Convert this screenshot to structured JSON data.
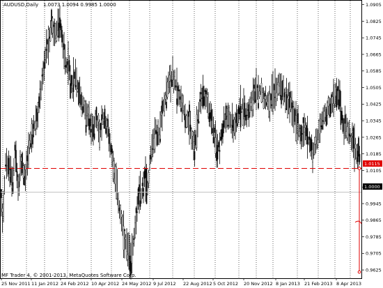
{
  "window": {
    "symbol_timeframe": "AUDUSD,Daily",
    "ohlc_readout": "1.0073 1.0094 0.9985 1.0000",
    "copyright": "MF Trader 4, © 2001-2013, MetaQuotes Software Corp."
  },
  "lines": {
    "bid_label": "1.0000",
    "order_level_label": "1.0115",
    "order_color": "#e00000",
    "bid_line_color": "#c0c0c0"
  },
  "chart_data": {
    "type": "candlestick",
    "title": "AUDUSD,Daily",
    "ylim": [
      0.9585,
      1.0924
    ],
    "y_ticks": [
      "1.0905",
      "1.0825",
      "1.0745",
      "1.0665",
      "1.0585",
      "1.0505",
      "1.0425",
      "1.0345",
      "1.0265",
      "1.0185",
      "1.0105",
      "1.0025",
      "0.9945",
      "0.9865",
      "0.9785",
      "0.9705",
      "0.9625"
    ],
    "x_ticks": [
      "25 Nov 2011",
      "11 Jan 2012",
      "24 Feb 2012",
      "10 Apr 2012",
      "24 May 2012",
      "9 Jul 2012",
      "22 Aug 2012",
      "5 Oct 2012",
      "20 Nov 2012",
      "8 Jan 2013",
      "21 Feb 2013",
      "8 Apr 2013"
    ],
    "grid": "vertical dotted",
    "series": [
      {
        "values": [
          [
            1,
            1.0
          ],
          [
            4,
            0.988
          ],
          [
            8,
            1.015
          ],
          [
            14,
            1.01
          ],
          [
            18,
            1.005
          ],
          [
            22,
            1.022
          ],
          [
            26,
            1.0
          ],
          [
            30,
            1.015
          ],
          [
            36,
            1.006
          ],
          [
            42,
            1.022
          ],
          [
            48,
            1.03
          ],
          [
            54,
            1.036
          ],
          [
            58,
            1.048
          ],
          [
            62,
            1.058
          ],
          [
            66,
            1.066
          ],
          [
            70,
            1.07
          ],
          [
            74,
            1.082
          ],
          [
            78,
            1.075
          ],
          [
            82,
            1.078
          ],
          [
            86,
            1.083
          ],
          [
            90,
            1.072
          ],
          [
            94,
            1.063
          ],
          [
            98,
            1.062
          ],
          [
            102,
            1.052
          ],
          [
            108,
            1.056
          ],
          [
            114,
            1.048
          ],
          [
            120,
            1.041
          ],
          [
            126,
            1.036
          ],
          [
            132,
            1.03
          ],
          [
            138,
            1.035
          ],
          [
            144,
            1.028
          ],
          [
            148,
            1.036
          ],
          [
            154,
            1.032
          ],
          [
            160,
            1.02
          ],
          [
            166,
            1.008
          ],
          [
            170,
            0.996
          ],
          [
            176,
            0.982
          ],
          [
            180,
            0.975
          ],
          [
            184,
            0.972
          ],
          [
            188,
            0.966
          ],
          [
            192,
            0.978
          ],
          [
            196,
            0.99
          ],
          [
            200,
            0.998
          ],
          [
            204,
            1.0
          ],
          [
            208,
            1.008
          ],
          [
            212,
            1.002
          ],
          [
            216,
            1.018
          ],
          [
            220,
            1.024
          ],
          [
            224,
            1.03
          ],
          [
            228,
            1.026
          ],
          [
            232,
            1.036
          ],
          [
            236,
            1.044
          ],
          [
            240,
            1.05
          ],
          [
            244,
            1.054
          ],
          [
            248,
            1.056
          ],
          [
            252,
            1.052
          ],
          [
            256,
            1.047
          ],
          [
            260,
            1.045
          ],
          [
            264,
            1.04
          ],
          [
            268,
            1.034
          ],
          [
            272,
            1.032
          ],
          [
            276,
            1.026
          ],
          [
            280,
            1.02
          ],
          [
            284,
            1.035
          ],
          [
            288,
            1.044
          ],
          [
            292,
            1.048
          ],
          [
            296,
            1.046
          ],
          [
            300,
            1.04
          ],
          [
            304,
            1.034
          ],
          [
            308,
            1.026
          ],
          [
            312,
            1.02
          ],
          [
            318,
            1.028
          ],
          [
            324,
            1.036
          ],
          [
            330,
            1.035
          ],
          [
            336,
            1.032
          ],
          [
            342,
            1.038
          ],
          [
            348,
            1.041
          ],
          [
            354,
            1.037
          ],
          [
            360,
            1.044
          ],
          [
            366,
            1.048
          ],
          [
            372,
            1.05
          ],
          [
            378,
            1.048
          ],
          [
            384,
            1.044
          ],
          [
            390,
            1.046
          ],
          [
            396,
            1.05
          ],
          [
            402,
            1.052
          ],
          [
            408,
            1.048
          ],
          [
            414,
            1.044
          ],
          [
            420,
            1.04
          ],
          [
            426,
            1.034
          ],
          [
            432,
            1.028
          ],
          [
            438,
            1.03
          ],
          [
            444,
            1.024
          ],
          [
            450,
            1.019
          ],
          [
            456,
            1.026
          ],
          [
            462,
            1.034
          ],
          [
            468,
            1.038
          ],
          [
            474,
            1.042
          ],
          [
            480,
            1.045
          ],
          [
            486,
            1.049
          ],
          [
            490,
            1.038
          ],
          [
            494,
            1.032
          ],
          [
            500,
            1.028
          ],
          [
            506,
            1.024
          ],
          [
            512,
            1.02
          ],
          [
            516,
            1.018
          ]
        ]
      }
    ]
  }
}
